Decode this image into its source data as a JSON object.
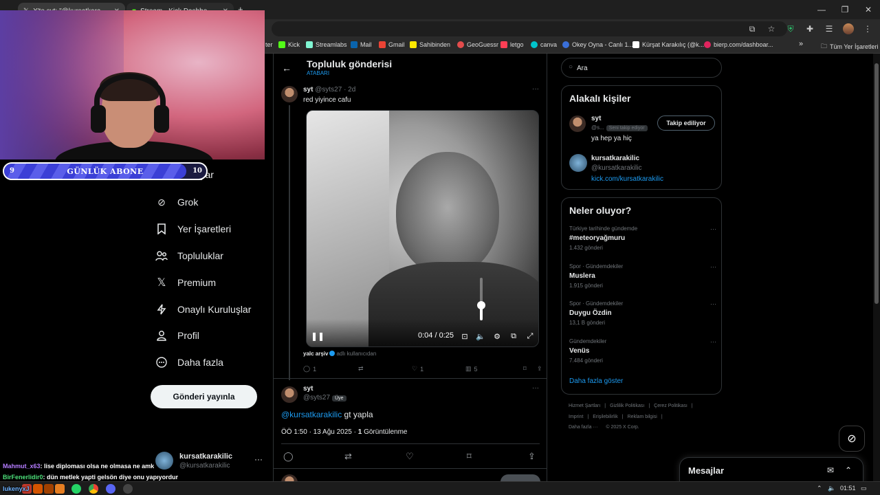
{
  "browser": {
    "tabs": [
      {
        "title": "X'te syt: \"@kursatkarakilic",
        "icon": "x-logo-icon"
      },
      {
        "title": "Stream - Kick Dashboard",
        "icon": "kick-logo-icon"
      }
    ],
    "new_tab": "+",
    "bookmarks": [
      {
        "label": "ter",
        "color": "#1d9bf0"
      },
      {
        "label": "Kick",
        "color": "#53fc18"
      },
      {
        "label": "Streamlabs",
        "color": "#80f5d2"
      },
      {
        "label": "Mail",
        "color": "#0a64ad"
      },
      {
        "label": "Gmail",
        "color": "#ea4335"
      },
      {
        "label": "Sahibinden",
        "color": "#ffe800"
      },
      {
        "label": "GeoGuessr",
        "color": "#e34c4c"
      },
      {
        "label": "letgo",
        "color": "#ff3f55"
      },
      {
        "label": "canva",
        "color": "#00c4cc"
      },
      {
        "label": "Okey Oyna - Canlı 1...",
        "color": "#3a6fd8"
      },
      {
        "label": "Kürşat Karakılıç (@k...",
        "color": "#ffffff"
      },
      {
        "label": "bierp.com/dashboar...",
        "color": "#e0245e"
      }
    ],
    "bookmarks_more": "»",
    "all_bookmarks": "Tüm Yer İşaretleri"
  },
  "stream": {
    "sub_goal": {
      "label": "GÜNLÜK ABONE",
      "current": "9",
      "target": "10",
      "progress": 0.9
    },
    "chat": [
      {
        "user": "Mahmut_x63",
        "color": "#b57dff",
        "message": ": lise diploması olsa ne olmasa ne amk"
      },
      {
        "user": "BirFenerlidir0",
        "color": "#4de07a",
        "message": ": dün metlek yapti gelsön diye onu yapıyordur"
      },
      {
        "user": "lukenyxJ",
        "color": "#6fb3ff",
        "message": ""
      }
    ]
  },
  "nav": {
    "items": [
      {
        "label": "Mesajlar",
        "icon": "envelope-icon"
      },
      {
        "label": "Grok",
        "icon": "grok-icon"
      },
      {
        "label": "Yer İşaretleri",
        "icon": "bookmark-icon"
      },
      {
        "label": "Topluluklar",
        "icon": "communities-icon"
      },
      {
        "label": "Premium",
        "icon": "x-logo-icon"
      },
      {
        "label": "Onaylı Kuruluşlar",
        "icon": "lightning-icon"
      },
      {
        "label": "Profil",
        "icon": "person-icon"
      },
      {
        "label": "Daha fazla",
        "icon": "more-circle-icon"
      }
    ],
    "post_button": "Gönderi yayınla",
    "account": {
      "name": "kursatkarakilic",
      "handle": "@kursatkarakilic",
      "more": "···"
    }
  },
  "center": {
    "header": {
      "title": "Topluluk gönderisi",
      "subtitle": "ATABARI"
    },
    "post": {
      "name": "syt",
      "meta": "@syts27 · 2d",
      "text": "red yiyince cafu",
      "video": {
        "time": "0:04 / 0:25",
        "volume_level": 0.35
      },
      "source_name": "yalc arşiv",
      "source_meta": "adlı kullanıcıdan",
      "stats": {
        "replies": "1",
        "reposts": "",
        "likes": "1",
        "views": "5"
      }
    },
    "reply": {
      "name": "syt",
      "handle": "@syts27",
      "badge": "Üye",
      "mention": "@kursatkarakilic",
      "text": " gt yapla",
      "time": "ÖÖ 1:50 · 13 Ağu 2025 · ",
      "views_count": "1",
      "views_label": " Görüntülenme"
    }
  },
  "right": {
    "search_placeholder": "Ara",
    "people": {
      "title": "Alakalı kişiler",
      "users": [
        {
          "name": "syt",
          "handle": "@s...",
          "follows_you": "Seni takip ediyor",
          "bio": "ya hep ya hiç",
          "button": "Takip ediliyor"
        },
        {
          "name": "kursatkarakilic",
          "handle": "@kursatkarakilic",
          "link": "kick.com/kursatkarakilic"
        }
      ]
    },
    "trends": {
      "title": "Neler oluyor?",
      "items": [
        {
          "context": "Türkiye tarihinde gündemde",
          "name": "#meteoryağmuru",
          "count": "1.432 gönderi"
        },
        {
          "context": "Spor · Gündemdekiler",
          "name": "Muslera",
          "count": "1.915 gönderi"
        },
        {
          "context": "Spor · Gündemdekiler",
          "name": "Duygu Özdin",
          "count": "13,1 B gönderi"
        },
        {
          "context": "Gündemdekiler",
          "name": "Venüs",
          "count": "7.484 gönderi"
        }
      ],
      "show_more": "Daha fazla göster"
    },
    "footer": {
      "row1": [
        "Hizmet Şartları",
        "|",
        "Gizlilik Politikası",
        "|",
        "Çerez Politikası",
        "|"
      ],
      "row2": [
        "Imprint",
        "|",
        "Erişilebilirlik",
        "|",
        "Reklam bilgisi",
        "|"
      ],
      "row3": [
        "Daha fazla ···",
        "© 2025 X Corp."
      ]
    },
    "messages_dock": "Mesajlar"
  },
  "taskbar": {
    "time": "01:51"
  }
}
